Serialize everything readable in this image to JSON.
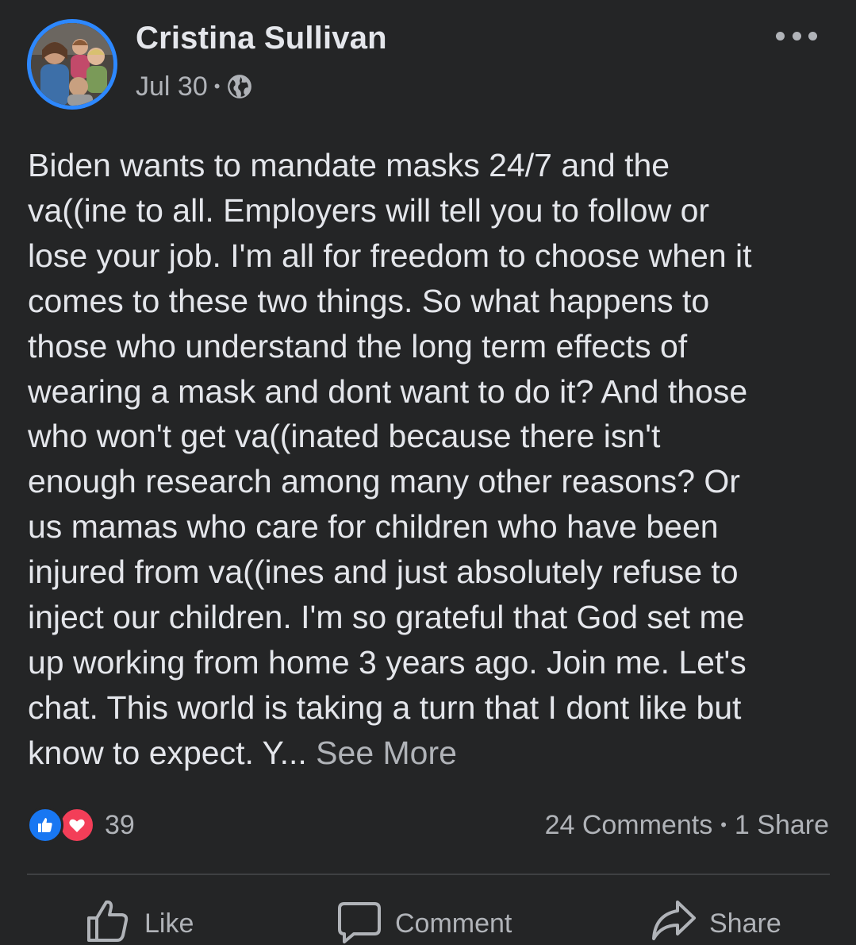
{
  "post": {
    "author": "Cristina Sullivan",
    "date": "Jul 30",
    "meta_separator": "•",
    "audience_icon": "globe-icon",
    "more_icon": "more-options-icon",
    "body": "Biden wants to mandate masks 24/7 and the\nva((ine to all. Employers will tell you to follow or\nlose your job. I'm all for freedom to choose when it\ncomes to these two things. So what happens to\nthose who understand the long term effects of\nwearing a mask and dont want to do it? And those\nwho won't get va((inated because there isn't\nenough research among many other reasons? Or\nus mamas who care for children who have been\ninjured from va((ines and just absolutely refuse to\ninject our children. I'm so grateful that God set me\nup working from home 3 years ago. Join me. Let's\nchat. This world is taking a turn that I dont like but\nknow to expect. Y...",
    "see_more": "See More"
  },
  "stats": {
    "reaction_icons": [
      "like-reaction-icon",
      "love-reaction-icon"
    ],
    "reaction_count": "39",
    "comments": "24 Comments",
    "separator": "•",
    "shares": "1 Share"
  },
  "actions": {
    "like": "Like",
    "comment": "Comment",
    "share": "Share"
  },
  "colors": {
    "background": "#242526",
    "text_primary": "#e4e6eb",
    "text_secondary": "#b0b3b8",
    "avatar_ring": "#2d88ff",
    "like_blue": "#1877f2",
    "love_red": "#f33e58",
    "divider": "#3e4042"
  }
}
